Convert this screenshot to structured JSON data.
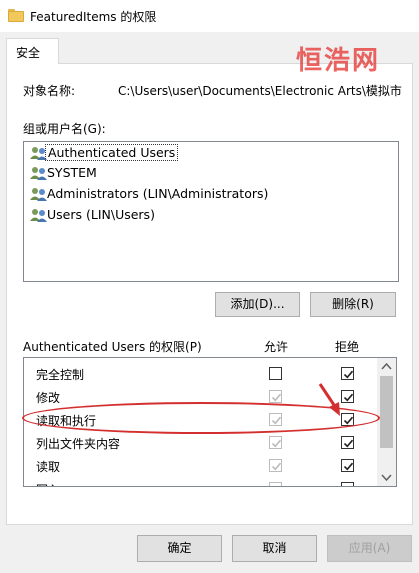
{
  "window": {
    "title": "FeaturedItems 的权限"
  },
  "tabs": [
    {
      "label": "安全"
    }
  ],
  "watermark": "恒浩网",
  "object": {
    "label": "对象名称:",
    "path": "C:\\Users\\user\\Documents\\Electronic Arts\\模拟市"
  },
  "group": {
    "label": "组或用户名(G):",
    "users": [
      {
        "name": "Authenticated Users",
        "selected": true
      },
      {
        "name": "SYSTEM"
      },
      {
        "name": "Administrators (LIN\\Administrators)"
      },
      {
        "name": "Users (LIN\\Users)"
      }
    ]
  },
  "buttons": {
    "add": "添加(D)...",
    "remove": "删除(R)"
  },
  "permissions": {
    "header": "Authenticated Users 的权限(P)",
    "allow_label": "允许",
    "deny_label": "拒绝",
    "rows": [
      {
        "name": "完全控制",
        "allow": false,
        "allow_inherited": false,
        "deny": true
      },
      {
        "name": "修改",
        "allow": true,
        "allow_inherited": true,
        "deny": true
      },
      {
        "name": "读取和执行",
        "allow": true,
        "allow_inherited": true,
        "deny": true
      },
      {
        "name": "列出文件夹内容",
        "allow": true,
        "allow_inherited": true,
        "deny": true
      },
      {
        "name": "读取",
        "allow": true,
        "allow_inherited": true,
        "deny": true
      },
      {
        "name": "写入",
        "allow": true,
        "allow_inherited": true,
        "deny": true
      }
    ]
  },
  "footer": {
    "ok": "确定",
    "cancel": "取消",
    "apply": "应用(A)"
  },
  "colors": {
    "accent_red": "#d32f2f",
    "window_bg": "#f0f0f0",
    "button_bg": "#e1e1e1"
  }
}
